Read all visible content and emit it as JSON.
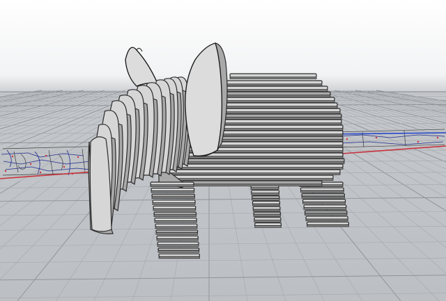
{
  "viewport": {
    "projection": "Perspective",
    "background_top": "#ffffff",
    "background_horizon": "#c4c7cb",
    "grid_color": "#a4a7ab",
    "x_axis_color": "#c8323c",
    "y_axis_color": "#2a49c9"
  },
  "model": {
    "object_icon": "elephant-model",
    "slice_fill": "#d6d6d6",
    "slice_shadow": "#a9a9a9",
    "cut_sheet_colors": [
      "#1f2a8c",
      "#c8323c",
      "#3a3a3a"
    ]
  }
}
